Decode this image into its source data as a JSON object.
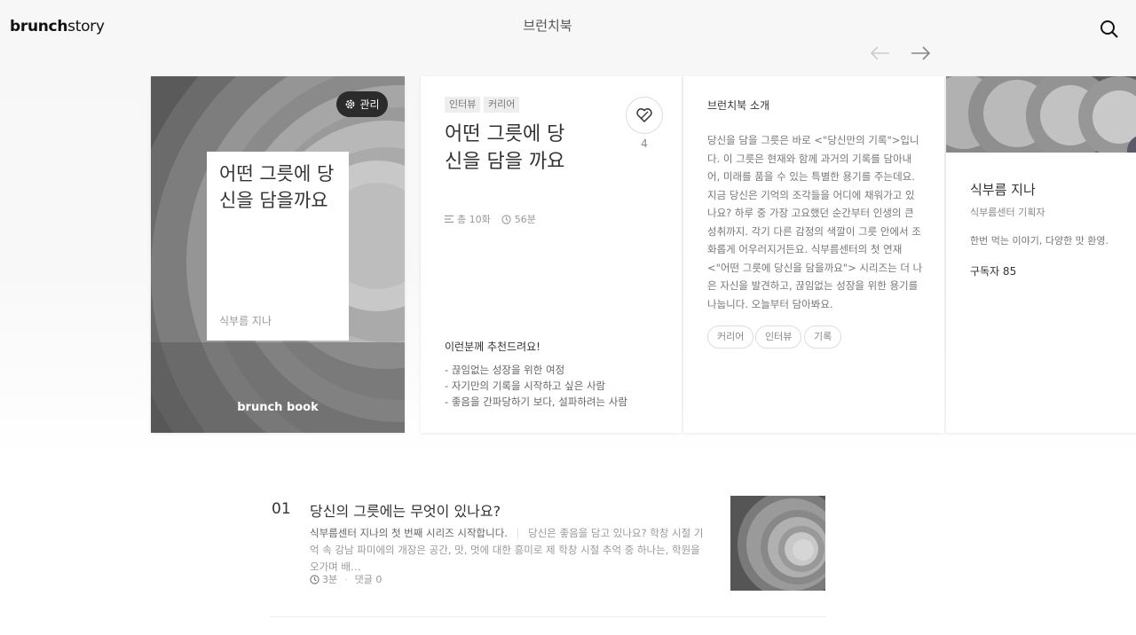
{
  "header": {
    "logo_bold": "brunch",
    "logo_light": "story",
    "title": "브런치북"
  },
  "cover": {
    "manage_label": "관리",
    "title": "어떤 그릇에 당신을 담을까요",
    "author": "식부름 지나",
    "brand": "brunch book"
  },
  "info": {
    "tags": [
      "인터뷰",
      "커리어"
    ],
    "title": "어떤 그릇에 당신을 담을 까요",
    "like_count": "4",
    "episodes": "총 10화",
    "duration": "56분",
    "recommend_title": "이런분께 추천드려요!",
    "recommend_items": [
      "끊임없는 성장을 위한 여정",
      "자기만의 기록을 시작하고 싶은 사람",
      "좋음을 간파당하기 보다, 설파하려는 사람"
    ]
  },
  "intro": {
    "heading": "브런치북 소개",
    "body": "당신을 담을 그릇은 바로 <\"당신만의 기록\">입니다. 이 그릇은 현재와 함께 과거의 기록를 담아내어, 미래를 품을 수 있는 특별한 용기를 주는데요. 지금 당신은 기억의 조각들을 어디에 채워가고 있나요? 하루 중 가장 고요했던 순간부터 인생의 큰 성취까지. 각기 다른 감정의 색깔이 그릇 안에서 조화롭게 어우러지거든요. 식부름센터의 첫 연재 <\"어떤 그릇에 당신을 담을까요\"> 시리즈는 더 나은 자신을 발견하고, 끊임없는 성장을 위한 용기를 나눕니다. 오늘부터 담아봐요.",
    "keywords": [
      "커리어",
      "인터뷰",
      "기록"
    ]
  },
  "author": {
    "name": "식부름 지나",
    "role": "식부름센터 기획자",
    "desc": "한번 먹는 이야기, 다양한 맛 환영.",
    "subscribers": "구독자 85"
  },
  "article": {
    "number": "01",
    "title": "당신의 그릇에는 무엇이 있나요?",
    "lead": "식부름센터 지나의 첫 번째 시리즈 시작합니다.",
    "excerpt": "당신은 좋음을 담고 있나요? 학창 시절 기억 속 강남 파미에의 개장은 공간, 맛, 멋에 대한 흥미로 제 학창 시절 추억 중 하나는, 학원을 오가며 배…",
    "read_time": "3분",
    "comments": "댓글 0"
  },
  "colors": {
    "accent": "#111111",
    "manage_bg": "#2b2b2b",
    "card_bg": "#ffffff",
    "muted_text": "#999999"
  },
  "icons": [
    "search-icon",
    "arrow-left-icon",
    "arrow-right-icon",
    "gear-icon",
    "like-icon",
    "list-icon",
    "clock-icon"
  ]
}
